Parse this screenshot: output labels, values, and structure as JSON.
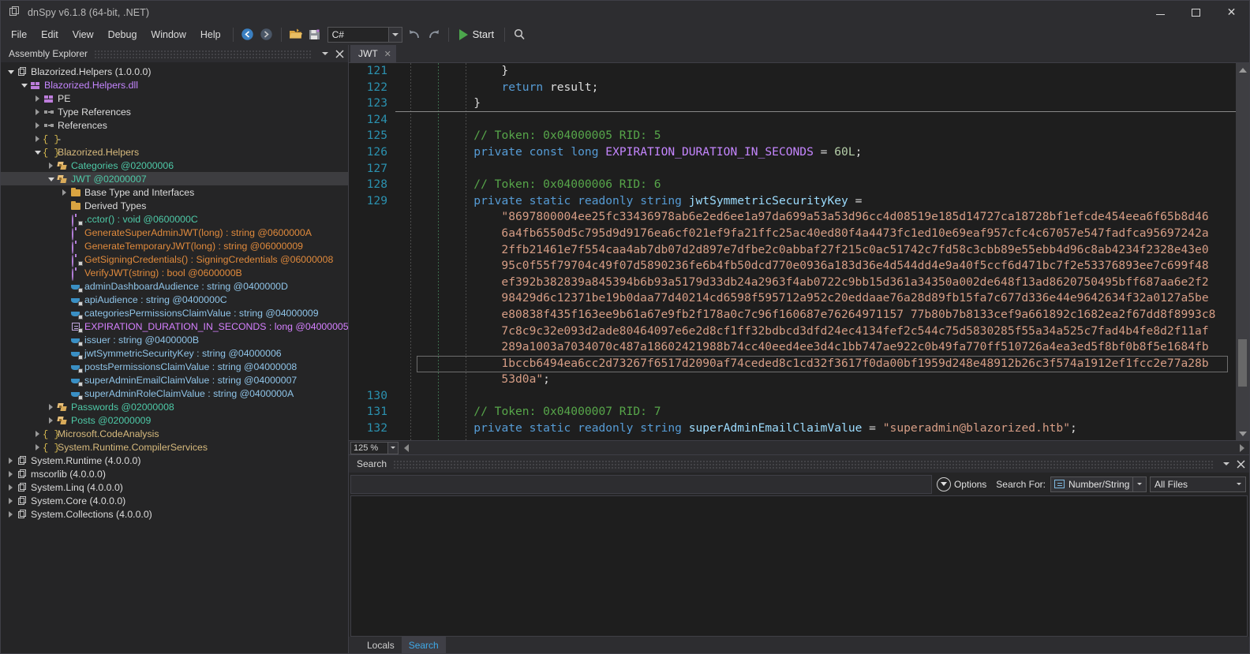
{
  "window": {
    "title": "dnSpy v6.1.8 (64-bit, .NET)",
    "icon": "app-window-icon",
    "minimize": "–",
    "maximize": "□",
    "close": "✕"
  },
  "menu": {
    "items": [
      "File",
      "Edit",
      "View",
      "Debug",
      "Window",
      "Help"
    ]
  },
  "toolbar": {
    "back_icon": "navigate-back-icon",
    "forward_icon": "navigate-forward-icon",
    "open_icon": "open-folder-icon",
    "save_icon": "save-module-icon",
    "language": "C#",
    "undo_icon": "undo-icon",
    "redo_icon": "redo-icon",
    "start_label": "Start",
    "search_icon": "search-magnifier-icon"
  },
  "assembly_explorer": {
    "title": "Assembly Explorer",
    "menu_icon": "chevron-down-icon",
    "close_icon": "close-icon",
    "tree": [
      {
        "label": "Blazorized.Helpers (1.0.0.0)",
        "indent": 0,
        "twist": "down",
        "icon": "assembly",
        "color": "white"
      },
      {
        "label": "Blazorized.Helpers.dll",
        "indent": 1,
        "twist": "down",
        "icon": "module",
        "color": "purple"
      },
      {
        "label": "PE",
        "indent": 2,
        "twist": "right",
        "icon": "module",
        "color": "white"
      },
      {
        "label": "Type References",
        "indent": 2,
        "twist": "right",
        "icon": "ref",
        "color": "white"
      },
      {
        "label": "References",
        "indent": 2,
        "twist": "right",
        "icon": "ref",
        "color": "white"
      },
      {
        "label": "-",
        "indent": 2,
        "twist": "right",
        "icon": "namespace",
        "color": "white"
      },
      {
        "label": "Blazorized.Helpers",
        "indent": 2,
        "twist": "down",
        "icon": "namespace",
        "color": "yellow"
      },
      {
        "label": "Categories @02000006",
        "indent": 3,
        "twist": "right",
        "icon": "class",
        "color": "green"
      },
      {
        "label": "JWT @02000007",
        "indent": 3,
        "twist": "down",
        "icon": "class",
        "color": "green",
        "selected": true
      },
      {
        "label": "Base Type and Interfaces",
        "indent": 4,
        "twist": "right",
        "icon": "folder",
        "color": "white"
      },
      {
        "label": "Derived Types",
        "indent": 4,
        "twist": "none",
        "icon": "folder",
        "color": "white"
      },
      {
        "label": ".cctor() : void @0600000C",
        "indent": 4,
        "twist": "none",
        "icon": "method-private",
        "color": "method-green"
      },
      {
        "label": "GenerateSuperAdminJWT(long) : string @0600000A",
        "indent": 4,
        "twist": "none",
        "icon": "method",
        "color": "orange"
      },
      {
        "label": "GenerateTemporaryJWT(long) : string @06000009",
        "indent": 4,
        "twist": "none",
        "icon": "method",
        "color": "orange"
      },
      {
        "label": "GetSigningCredentials() : SigningCredentials @06000008",
        "indent": 4,
        "twist": "none",
        "icon": "method-private",
        "color": "orange-green"
      },
      {
        "label": "VerifyJWT(string) : bool @0600000B",
        "indent": 4,
        "twist": "none",
        "icon": "method",
        "color": "orange"
      },
      {
        "label": "adminDashboardAudience : string @0400000D",
        "indent": 4,
        "twist": "none",
        "icon": "field-private",
        "color": "lblue"
      },
      {
        "label": "apiAudience : string @0400000C",
        "indent": 4,
        "twist": "none",
        "icon": "field-private",
        "color": "lblue"
      },
      {
        "label": "categoriesPermissionsClaimValue : string @04000009",
        "indent": 4,
        "twist": "none",
        "icon": "field-private",
        "color": "lblue"
      },
      {
        "label": "EXPIRATION_DURATION_IN_SECONDS : long @04000005",
        "indent": 4,
        "twist": "none",
        "icon": "const-private",
        "color": "const"
      },
      {
        "label": "issuer : string @0400000B",
        "indent": 4,
        "twist": "none",
        "icon": "field-private",
        "color": "lblue"
      },
      {
        "label": "jwtSymmetricSecurityKey : string @04000006",
        "indent": 4,
        "twist": "none",
        "icon": "field-private",
        "color": "lblue"
      },
      {
        "label": "postsPermissionsClaimValue : string @04000008",
        "indent": 4,
        "twist": "none",
        "icon": "field-private",
        "color": "lblue"
      },
      {
        "label": "superAdminEmailClaimValue : string @04000007",
        "indent": 4,
        "twist": "none",
        "icon": "field-private",
        "color": "lblue"
      },
      {
        "label": "superAdminRoleClaimValue : string @0400000A",
        "indent": 4,
        "twist": "none",
        "icon": "field-private",
        "color": "lblue"
      },
      {
        "label": "Passwords @02000008",
        "indent": 3,
        "twist": "right",
        "icon": "class",
        "color": "green"
      },
      {
        "label": "Posts @02000009",
        "indent": 3,
        "twist": "right",
        "icon": "class",
        "color": "green"
      },
      {
        "label": "Microsoft.CodeAnalysis",
        "indent": 2,
        "twist": "right",
        "icon": "namespace",
        "color": "yellow"
      },
      {
        "label": "System.Runtime.CompilerServices",
        "indent": 2,
        "twist": "right",
        "icon": "namespace",
        "color": "yellow"
      },
      {
        "label": "System.Runtime (4.0.0.0)",
        "indent": 0,
        "twist": "right",
        "icon": "assembly",
        "color": "white"
      },
      {
        "label": "mscorlib (4.0.0.0)",
        "indent": 0,
        "twist": "right",
        "icon": "assembly",
        "color": "white"
      },
      {
        "label": "System.Linq (4.0.0.0)",
        "indent": 0,
        "twist": "right",
        "icon": "assembly",
        "color": "white"
      },
      {
        "label": "System.Core (4.0.0.0)",
        "indent": 0,
        "twist": "right",
        "icon": "assembly",
        "color": "white"
      },
      {
        "label": "System.Collections (4.0.0.0)",
        "indent": 0,
        "twist": "right",
        "icon": "assembly",
        "color": "white"
      }
    ]
  },
  "document_tab": {
    "label": "JWT",
    "close_icon": "close-icon"
  },
  "editor": {
    "zoom": "125 %",
    "first_line": 121,
    "lines": [
      {
        "n": "121",
        "segments": [
          {
            "t": "            }",
            "c": "punct"
          }
        ]
      },
      {
        "n": "122",
        "segments": [
          {
            "t": "            ",
            "c": "punct"
          },
          {
            "t": "return",
            "c": "kw"
          },
          {
            "t": " result;",
            "c": "punct"
          }
        ]
      },
      {
        "n": "123",
        "segments": [
          {
            "t": "        }",
            "c": "punct"
          }
        ],
        "sep_below": true
      },
      {
        "n": "124",
        "segments": [
          {
            "t": "",
            "c": "punct"
          }
        ]
      },
      {
        "n": "125",
        "segments": [
          {
            "t": "        ",
            "c": "punct"
          },
          {
            "t": "// Token: 0x04000005 RID: 5",
            "c": "cmt"
          }
        ]
      },
      {
        "n": "126",
        "segments": [
          {
            "t": "        ",
            "c": "punct"
          },
          {
            "t": "private",
            "c": "kw"
          },
          {
            "t": " ",
            "c": "punct"
          },
          {
            "t": "const",
            "c": "kw"
          },
          {
            "t": " ",
            "c": "punct"
          },
          {
            "t": "long",
            "c": "kw"
          },
          {
            "t": " ",
            "c": "punct"
          },
          {
            "t": "EXPIRATION_DURATION_IN_SECONDS",
            "c": "constf"
          },
          {
            "t": " = ",
            "c": "punct"
          },
          {
            "t": "60L",
            "c": "num"
          },
          {
            "t": ";",
            "c": "punct"
          }
        ]
      },
      {
        "n": "127",
        "segments": [
          {
            "t": "",
            "c": "punct"
          }
        ]
      },
      {
        "n": "128",
        "segments": [
          {
            "t": "        ",
            "c": "punct"
          },
          {
            "t": "// Token: 0x04000006 RID: 6",
            "c": "cmt"
          }
        ]
      },
      {
        "n": "129",
        "segments": [
          {
            "t": "        ",
            "c": "punct"
          },
          {
            "t": "private",
            "c": "kw"
          },
          {
            "t": " ",
            "c": "punct"
          },
          {
            "t": "static",
            "c": "kw"
          },
          {
            "t": " ",
            "c": "punct"
          },
          {
            "t": "readonly",
            "c": "kw"
          },
          {
            "t": " ",
            "c": "punct"
          },
          {
            "t": "string",
            "c": "kw"
          },
          {
            "t": " ",
            "c": "punct"
          },
          {
            "t": "jwtSymmetricSecurityKey",
            "c": "field"
          },
          {
            "t": " =",
            "c": "punct"
          }
        ]
      },
      {
        "n": "",
        "segments": [
          {
            "t": "            \"8697800004ee25fc33436978ab6e2ed6ee1a97da699a53a53d96cc4d08519e185d14727ca18728bf1efcde454eea6f65b8d46",
            "c": "str"
          }
        ]
      },
      {
        "n": "",
        "segments": [
          {
            "t": "            6a4fb6550d5c795d9d9176ea6cf021ef9fa21ffc25ac40ed80f4a4473fc1ed10e69eaf957cfc4c67057e547fadfca95697242a",
            "c": "str"
          }
        ]
      },
      {
        "n": "",
        "segments": [
          {
            "t": "            2ffb21461e7f554caa4ab7db07d2d897e7dfbe2c0abbaf27f215c0ac51742c7fd58c3cbb89e55ebb4d96c8ab4234f2328e43e0",
            "c": "str"
          }
        ]
      },
      {
        "n": "",
        "segments": [
          {
            "t": "            95c0f55f79704c49f07d5890236fe6b4fb50dcd770e0936a183d36e4d544dd4e9a40f5ccf6d471bc7f2e53376893ee7c699f48",
            "c": "str"
          }
        ]
      },
      {
        "n": "",
        "segments": [
          {
            "t": "            ef392b382839a845394b6b93a5179d33db24a2963f4ab0722c9bb15d361a34350a002de648f13ad8620750495bff687aa6e2f2",
            "c": "str"
          }
        ]
      },
      {
        "n": "",
        "segments": [
          {
            "t": "            98429d6c12371be19b0daa77d40214cd6598f595712a952c20eddaae76a28d89fb15fa7c677d336e44e9642634f32a0127a5be",
            "c": "str"
          }
        ]
      },
      {
        "n": "",
        "segments": [
          {
            "t": "            e80838f435f163ee9b61a67e9fb2f178a0c7c96f160687e76264971157 77b80b7b8133cef9a661892c1682ea2f67dd8f8993c8",
            "c": "str"
          }
        ]
      },
      {
        "n": "",
        "segments": [
          {
            "t": "            7c8c9c32e093d2ade80464097e6e2d8cf1ff32bdbcd3dfd24ec4134fef2c544c75d5830285f55a34a525c7fad4b4fe8d2f11af",
            "c": "str"
          }
        ]
      },
      {
        "n": "",
        "segments": [
          {
            "t": "            289a1003a7034070c487a18602421988b74cc40eed4ee3d4c1bb747ae922c0b49fa770ff510726a4ea3ed5f8bf0b8f5e1684fb",
            "c": "str"
          }
        ]
      },
      {
        "n": "",
        "segments": [
          {
            "t": "            1bccb6494ea6cc2d73267f6517d2090af74ceded8c1cd32f3617f0da00bf1959d248e48912b26c3f574a1912ef1fcc2e77a28b",
            "c": "str"
          }
        ],
        "current": true
      },
      {
        "n": "",
        "segments": [
          {
            "t": "            53d0a\"",
            "c": "str"
          },
          {
            "t": ";",
            "c": "punct"
          }
        ]
      },
      {
        "n": "130",
        "segments": [
          {
            "t": "",
            "c": "punct"
          }
        ]
      },
      {
        "n": "131",
        "segments": [
          {
            "t": "        ",
            "c": "punct"
          },
          {
            "t": "// Token: 0x04000007 RID: 7",
            "c": "cmt"
          }
        ]
      },
      {
        "n": "132",
        "segments": [
          {
            "t": "        ",
            "c": "punct"
          },
          {
            "t": "private",
            "c": "kw"
          },
          {
            "t": " ",
            "c": "punct"
          },
          {
            "t": "static",
            "c": "kw"
          },
          {
            "t": " ",
            "c": "punct"
          },
          {
            "t": "readonly",
            "c": "kw"
          },
          {
            "t": " ",
            "c": "punct"
          },
          {
            "t": "string",
            "c": "kw"
          },
          {
            "t": " ",
            "c": "punct"
          },
          {
            "t": "superAdminEmailClaimValue",
            "c": "field"
          },
          {
            "t": " = ",
            "c": "punct"
          },
          {
            "t": "\"superadmin@blazorized.htb\"",
            "c": "str"
          },
          {
            "t": ";",
            "c": "punct"
          }
        ]
      }
    ]
  },
  "search_panel": {
    "title": "Search",
    "menu_icon": "chevron-down-icon",
    "close_icon": "close-icon",
    "input_value": "",
    "options_label": "Options",
    "options_icon": "chevron-down-circle-icon",
    "search_for_label": "Search For:",
    "search_for_value": "Number/String",
    "search_for_icon": "number-string-icon",
    "file_filter_value": "All Files",
    "tabs": [
      {
        "label": "Locals",
        "active": false
      },
      {
        "label": "Search",
        "active": true
      }
    ]
  },
  "colors": {
    "accent_blue": "#2b91af",
    "string": "#d69d85",
    "keyword": "#569cd6",
    "comment": "#57a64a",
    "background": "#1e1e1e",
    "chrome": "#2d2d30"
  }
}
